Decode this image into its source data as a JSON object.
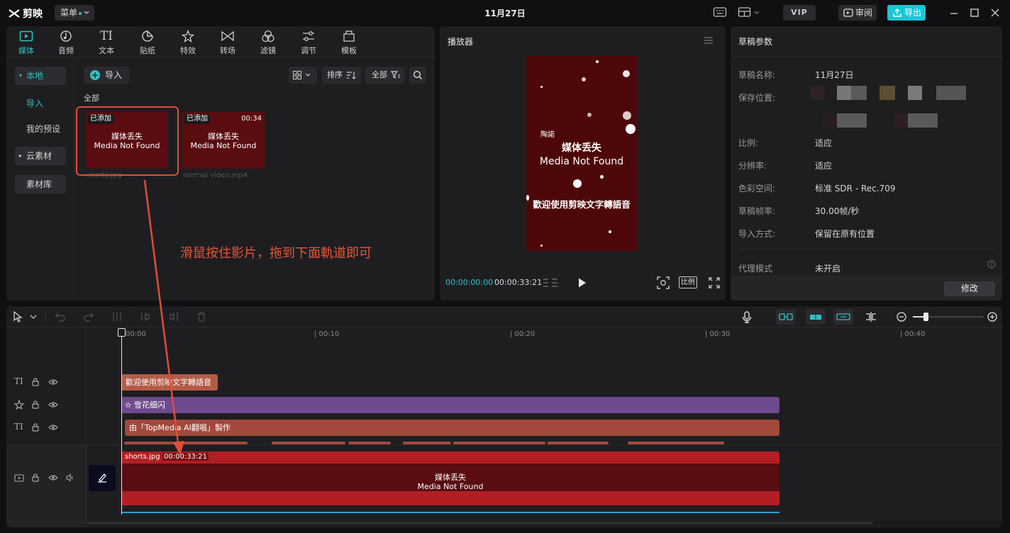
{
  "app": {
    "name": "剪映",
    "menu_label": "菜单",
    "project_title": "11月27日",
    "vip_label": "VIP",
    "review_label": "审阅",
    "export_label": "导出"
  },
  "media_tabs": [
    {
      "label": "媒体",
      "icon": "media-icon",
      "active": true
    },
    {
      "label": "音频",
      "icon": "audio-icon"
    },
    {
      "label": "文本",
      "icon": "text-icon"
    },
    {
      "label": "贴纸",
      "icon": "sticker-icon"
    },
    {
      "label": "特效",
      "icon": "effects-icon"
    },
    {
      "label": "转场",
      "icon": "transition-icon"
    },
    {
      "label": "滤镜",
      "icon": "filter-icon"
    },
    {
      "label": "调节",
      "icon": "adjust-icon"
    },
    {
      "label": "模板",
      "icon": "template-icon"
    }
  ],
  "sidebar": {
    "local": "本地",
    "import": "导入",
    "my_presets": "我的预设",
    "cloud": "云素材",
    "library": "素材库"
  },
  "media_toolbar": {
    "import": "导入",
    "sort": "排序",
    "filter_all": "全部",
    "section_all": "全部"
  },
  "media_items": [
    {
      "badge": "已添加",
      "duration": "",
      "line1": "媒体丢失",
      "line2": "Media Not Found",
      "name": "shorts.jpg"
    },
    {
      "badge": "已添加",
      "duration": "00:34",
      "line1": "媒体丢失",
      "line2": "Media Not Found",
      "name": "normal video.mp4"
    }
  ],
  "annotation": "滑鼠按住影片，拖到下面軌道即可",
  "player": {
    "title": "播放器",
    "screen_small": "陶諾",
    "screen_line1": "媒体丢失",
    "screen_line2": "Media Not Found",
    "screen_caption": "歡迎使用剪映文字轉語音",
    "current_time": "00:00:00:00",
    "total_time": "00:00:33:21",
    "ratio_label": "比例"
  },
  "draft": {
    "title": "草稿参数",
    "rows": [
      {
        "label": "草稿名称:",
        "value": "11月27日"
      },
      {
        "label": "保存位置:",
        "value": ""
      },
      {
        "label": "比例:",
        "value": "适应"
      },
      {
        "label": "分辨率:",
        "value": "适应"
      },
      {
        "label": "色彩空间:",
        "value": "标准 SDR - Rec.709"
      },
      {
        "label": "草稿帧率:",
        "value": "30.00帧/秒"
      },
      {
        "label": "导入方式:",
        "value": "保留在原有位置"
      },
      {
        "label": "代理模式",
        "value": "未开启"
      }
    ],
    "modify": "修改"
  },
  "timeline": {
    "ticks": [
      "00:00",
      "| 00:10",
      "| 00:20",
      "| 00:30",
      "| 00:40"
    ],
    "clips": {
      "text1": "歡迎使用剪映文字轉語音",
      "effect": "雪花细闪",
      "text2": "由「TopMedia AI翻唱」製作",
      "main_name": "shorts.jpg",
      "main_duration": "00:00:33:21",
      "main_line1": "媒体丢失",
      "main_line2": "Media Not Found"
    }
  },
  "colors": {
    "accent": "#2fc2c2",
    "export": "#19c6d6",
    "annotation": "#ea5535",
    "main_clip": "#b21e22",
    "effect_clip": "#6f4a8e",
    "text_clip": "#a2493b"
  }
}
